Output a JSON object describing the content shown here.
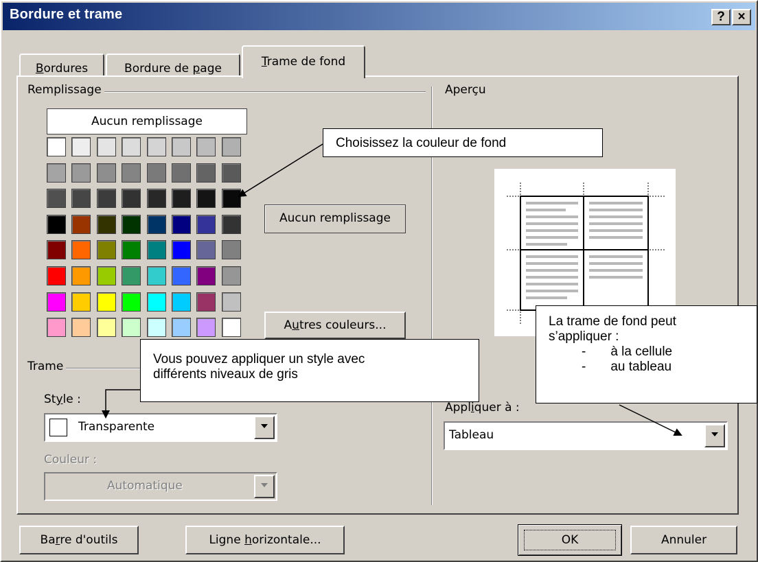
{
  "window": {
    "title": "Bordure et trame",
    "help_button": "?",
    "close_button": "×"
  },
  "tabs": [
    {
      "pre": "",
      "key": "B",
      "post": "ordures"
    },
    {
      "pre": "Bordure de ",
      "key": "p",
      "post": "age"
    },
    {
      "pre": "",
      "key": "T",
      "post": "rame de fond"
    }
  ],
  "fill": {
    "group_label": "Remplissage",
    "no_fill_button": "Aucun remplissage",
    "selected_name": "Aucun remplissage",
    "more_colors": {
      "pre": "A",
      "key": "u",
      "post": "tres couleurs..."
    },
    "palette": [
      [
        "#ffffff",
        "#eeeeee",
        "#e4e4e4",
        "#dcdcdc",
        "#d4d4d4",
        "#c8c8c8",
        "#bcbcbc",
        "#b0b0b0"
      ],
      [
        "#a4a4a4",
        "#9a9a9a",
        "#8e8e8e",
        "#848484",
        "#7a7a7a",
        "#707070",
        "#646464",
        "#5a5a5a"
      ],
      [
        "#505050",
        "#464646",
        "#3c3c3c",
        "#323232",
        "#282828",
        "#1e1e1e",
        "#141414",
        "#0a0a0a"
      ],
      [
        "#000000",
        "#993300",
        "#333300",
        "#003300",
        "#003366",
        "#000080",
        "#333399",
        "#333333"
      ],
      [
        "#800000",
        "#ff6600",
        "#808000",
        "#008000",
        "#008080",
        "#0000ff",
        "#666699",
        "#808080"
      ],
      [
        "#ff0000",
        "#ff9900",
        "#99cc00",
        "#339966",
        "#33cccc",
        "#3366ff",
        "#800080",
        "#969696"
      ],
      [
        "#ff00ff",
        "#ffcc00",
        "#ffff00",
        "#00ff00",
        "#00ffff",
        "#00ccff",
        "#993366",
        "#c0c0c0"
      ],
      [
        "#ff99cc",
        "#ffcc99",
        "#ffff99",
        "#ccffcc",
        "#ccffff",
        "#99ccff",
        "#cc99ff",
        "#ffffff"
      ]
    ]
  },
  "shading": {
    "group_label": "Trame",
    "style_label": {
      "pre": "St",
      "key": "y",
      "post": "le :"
    },
    "style_value": "Transparente",
    "color_label": "Couleur :",
    "color_value": "Automatique"
  },
  "preview": {
    "group_label": "Aperçu",
    "apply_label": {
      "pre": "Appl",
      "key": "i",
      "post": "quer à :"
    },
    "apply_value": "Tableau"
  },
  "footer": {
    "toolbar": {
      "pre": "Ba",
      "key": "r",
      "post": "re d'outils"
    },
    "horizontal_line": {
      "pre": "Ligne ",
      "key": "h",
      "post": "orizontale..."
    },
    "ok": "OK",
    "cancel": "Annuler"
  },
  "callouts": {
    "color": "Choisissez la couleur de fond",
    "style": [
      "Vous  pouvez appliquer un style avec",
      "différents niveaux de gris"
    ],
    "apply": {
      "line1": "La trame de fond peut",
      "line2": "s’appliquer :",
      "items": [
        "à la cellule",
        "au tableau"
      ],
      "dash": "-"
    }
  }
}
